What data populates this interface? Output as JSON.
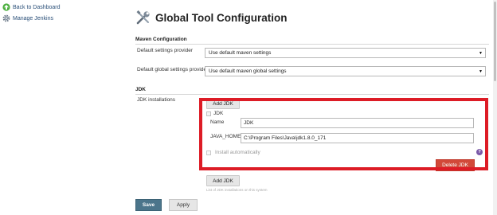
{
  "sidebar": {
    "items": [
      {
        "label": "Back to Dashboard",
        "icon": "up-arrow-icon"
      },
      {
        "label": "Manage Jenkins",
        "icon": "gear-icon"
      }
    ]
  },
  "header": {
    "title": "Global Tool Configuration",
    "icon": "tools-icon"
  },
  "maven": {
    "section_title": "Maven Configuration",
    "default_settings_label": "Default settings provider",
    "default_settings_value": "Use default maven settings",
    "global_settings_label": "Default global settings provider",
    "global_settings_value": "Use default maven global settings"
  },
  "jdk": {
    "section_title": "JDK",
    "installations_label": "JDK installations",
    "add_button": "Add JDK",
    "entry_header": "JDK",
    "name_label": "Name",
    "name_value": "JDK",
    "java_home_label": "JAVA_HOME",
    "java_home_value": "C:\\Program Files\\Java\\jdk1.8.0_171",
    "install_auto_label": "Install automatically",
    "delete_button": "Delete JDK",
    "add_button_bottom": "Add JDK",
    "list_note": "List of JDK installations on this system"
  },
  "footer": {
    "save_label": "Save",
    "apply_label": "Apply"
  },
  "colors": {
    "highlight": "#dd1c26",
    "save": "#4b758b",
    "delete": "#d24939",
    "link": "#2a4f78"
  }
}
